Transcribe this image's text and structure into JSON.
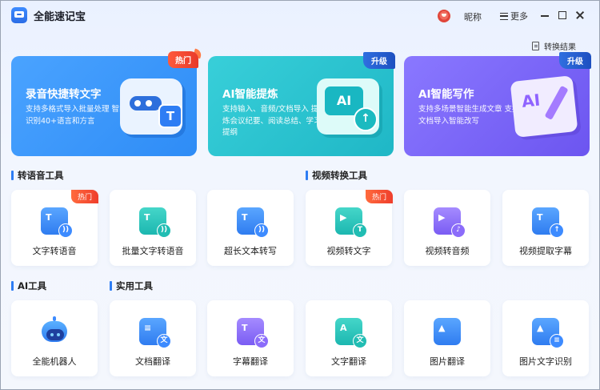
{
  "app": {
    "title": "全能速记宝"
  },
  "header": {
    "nickname": "昵称",
    "more_label": "更多",
    "result_label": "转换结果"
  },
  "banners": [
    {
      "title": "录音快捷转文字",
      "desc": "支持多格式导入批量处理 智能识别40+语言和方言",
      "tag": "热门",
      "tag_type": "hot",
      "color": "#3a97fb"
    },
    {
      "title": "AI智能提炼",
      "desc": "支持输入、音频/文档导入 提炼会议纪要、阅读总结、学习提纲",
      "tag": "升级",
      "tag_type": "upgrade",
      "color": "#2ec4cf"
    },
    {
      "title": "AI智能写作",
      "desc": "支持多场景智能生成文章 支持文档导入智能改写",
      "tag": "升级",
      "tag_type": "upgrade",
      "color": "#7b66f8"
    }
  ],
  "sections": {
    "speech": {
      "title": "转语音工具"
    },
    "video": {
      "title": "视频转换工具"
    },
    "ai": {
      "title": "AI工具"
    },
    "util": {
      "title": "实用工具"
    }
  },
  "tools": [
    {
      "label": "文字转语音",
      "icon": "text-to-speech-icon",
      "tag": "热门"
    },
    {
      "label": "批量文字转语音",
      "icon": "batch-text-to-speech-icon"
    },
    {
      "label": "超长文本转写",
      "icon": "long-text-icon"
    },
    {
      "label": "视频转文字",
      "icon": "video-to-text-icon",
      "tag": "热门"
    },
    {
      "label": "视频转音频",
      "icon": "video-to-audio-icon"
    },
    {
      "label": "视频提取字幕",
      "icon": "video-subtitle-icon"
    },
    {
      "label": "全能机器人",
      "icon": "robot-icon"
    },
    {
      "label": "文档翻译",
      "icon": "document-translate-icon"
    },
    {
      "label": "字幕翻译",
      "icon": "subtitle-translate-icon"
    },
    {
      "label": "文字翻译",
      "icon": "text-translate-icon"
    },
    {
      "label": "图片翻译",
      "icon": "image-translate-icon"
    },
    {
      "label": "图片文字识别",
      "icon": "image-ocr-icon"
    }
  ]
}
